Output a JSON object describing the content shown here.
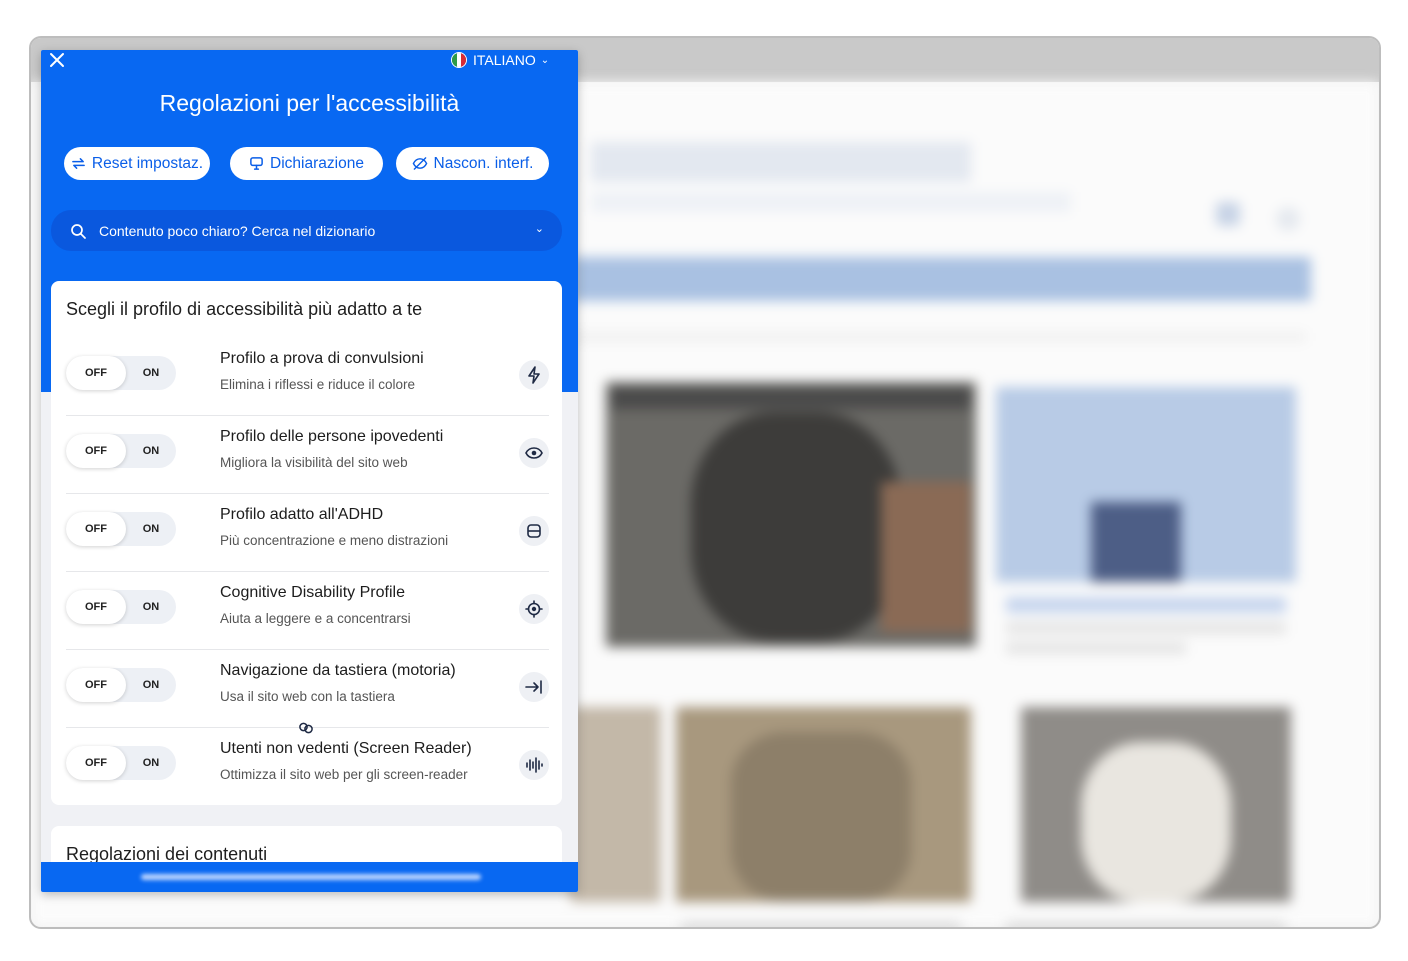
{
  "panel": {
    "title": "Regolazioni per l'accessibilità",
    "language": "ITALIANO",
    "buttons": {
      "reset": "Reset impostaz.",
      "statement": "Dichiarazione",
      "hide": "Nascon. interf."
    },
    "search": {
      "label": "Contenuto poco chiaro? Cerca nel dizionario"
    },
    "profiles": {
      "heading": "Scegli il profilo di accessibilità più adatto a te",
      "toggle_off": "OFF",
      "toggle_on": "ON",
      "items": [
        {
          "title": "Profilo a prova di convulsioni",
          "subtitle": "Elimina i riflessi e riduce il colore",
          "icon": "lightning-icon"
        },
        {
          "title": "Profilo delle persone ipovedenti",
          "subtitle": "Migliora la visibilità del sito web",
          "icon": "eye-icon"
        },
        {
          "title": "Profilo adatto all'ADHD",
          "subtitle": "Più concentrazione e meno distrazioni",
          "icon": "focus-frame-icon"
        },
        {
          "title": "Cognitive Disability Profile",
          "subtitle": "Aiuta a leggere e a concentrarsi",
          "icon": "target-icon"
        },
        {
          "title": "Navigazione da tastiera (motoria)",
          "subtitle": "Usa il sito web con la tastiera",
          "icon": "tab-arrow-icon"
        },
        {
          "title": "Utenti non vedenti (Screen Reader)",
          "subtitle": "Ottimizza il sito web per gli screen-reader",
          "icon": "audio-wave-icon"
        }
      ]
    },
    "content_settings": {
      "heading": "Regolazioni dei contenuti"
    }
  },
  "colors": {
    "accent": "#0868f2",
    "search_bg": "#0a58de"
  }
}
